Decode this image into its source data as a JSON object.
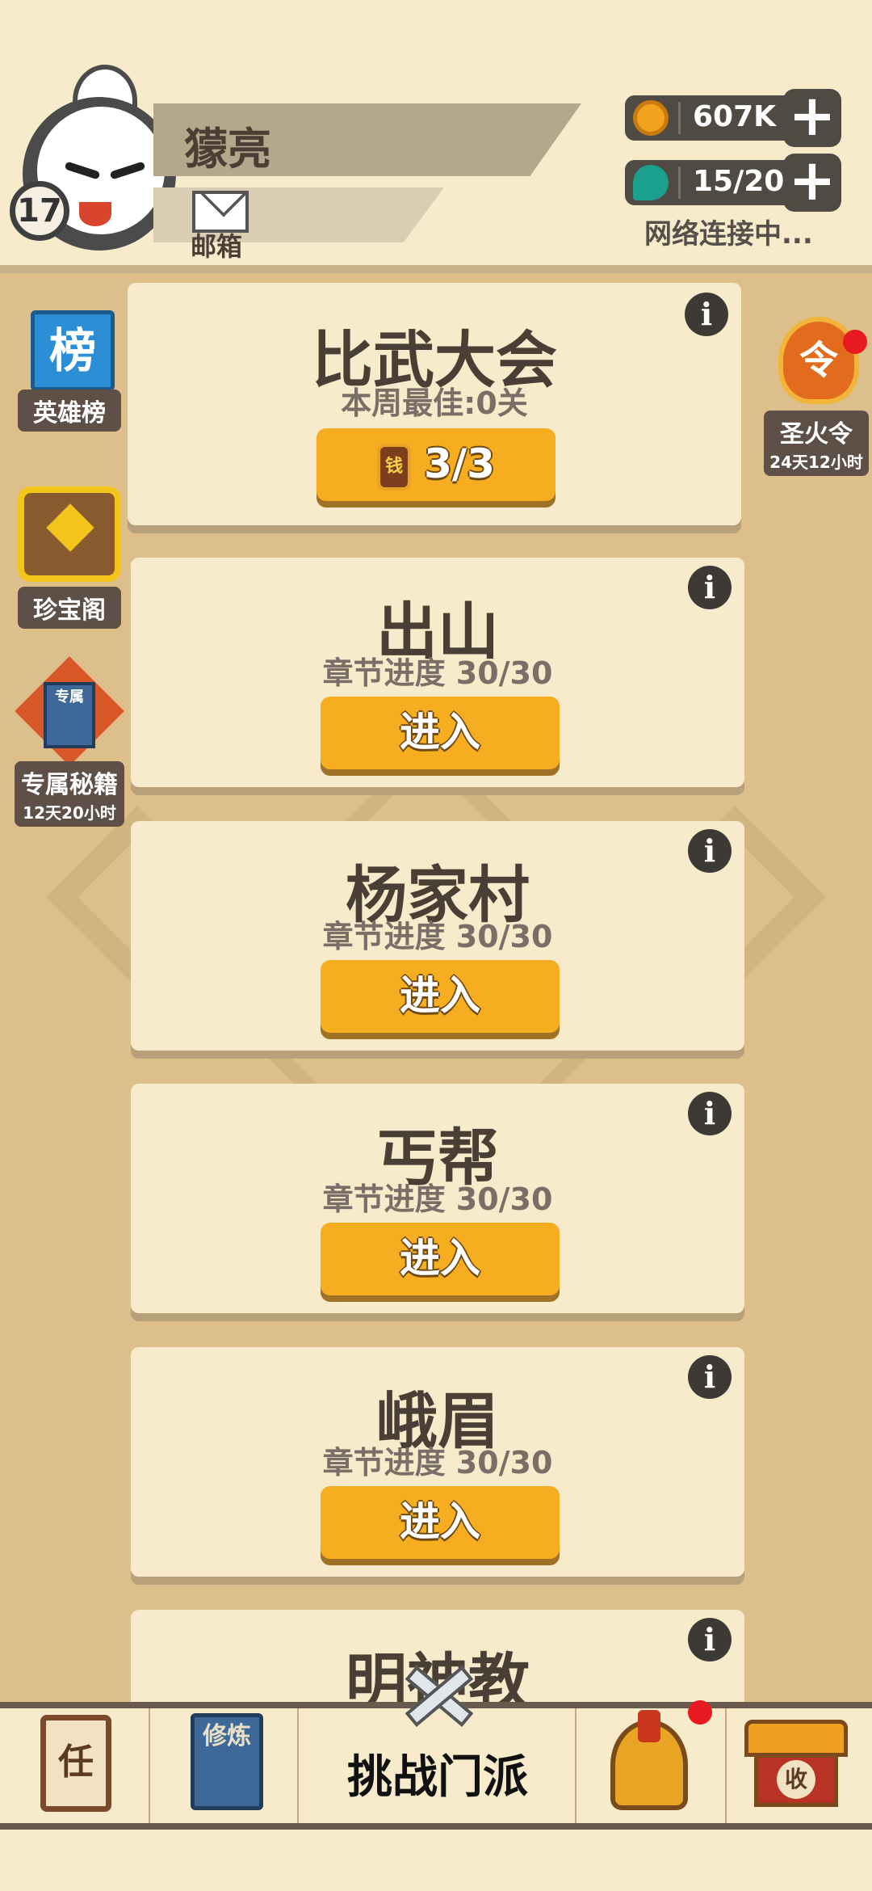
{
  "player": {
    "name": "獴亮",
    "level": "17",
    "mail_label": "邮箱"
  },
  "resources": {
    "coins": "607K",
    "energy": "15/20",
    "network_status": "网络连接中..."
  },
  "side_left": [
    {
      "label": "英雄榜",
      "icon_char": "榜"
    },
    {
      "label": "珍宝阁"
    },
    {
      "label": "专属秘籍",
      "timer": "12天20小时",
      "icon_char": "专属"
    }
  ],
  "side_right": {
    "label": "圣火令",
    "timer": "24天12小时",
    "icon_char": "令"
  },
  "tournament": {
    "title": "比武大会",
    "subtitle": "本周最佳:0关",
    "ticket_icon_char": "钱",
    "tickets": "3/3"
  },
  "stages": [
    {
      "title": "出山",
      "progress": "章节进度 30/30",
      "button": "进入"
    },
    {
      "title": "杨家村",
      "progress": "章节进度 30/30",
      "button": "进入"
    },
    {
      "title": "丐帮",
      "progress": "章节进度 30/30",
      "button": "进入"
    },
    {
      "title": "峨眉",
      "progress": "章节进度 30/30",
      "button": "进入"
    },
    {
      "title": "明神教"
    }
  ],
  "info_glyph": "i",
  "bottom_nav": {
    "task_char": "任",
    "cultivate_chars": "修炼",
    "challenge_label": "挑战门派",
    "collect_char": "收"
  },
  "colors": {
    "accent_orange": "#f6ad1f",
    "card_bg": "#f7ebcc",
    "page_bg": "#dcbf8a",
    "notify_red": "#e8191f"
  }
}
